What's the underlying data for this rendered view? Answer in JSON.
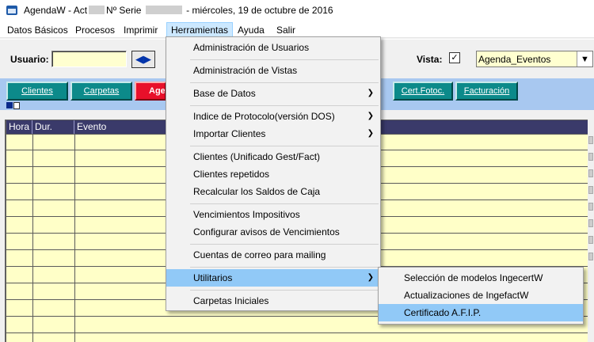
{
  "window": {
    "title_prefix": "AgendaW - Act",
    "title_serie": "Nº Serie",
    "title_date": "- miércoles, 19 de octubre de 2016"
  },
  "menubar": {
    "items": [
      {
        "label": "Datos Básicos"
      },
      {
        "label": "Procesos"
      },
      {
        "label": "Imprimir"
      },
      {
        "label": "Herramientas",
        "active": true
      },
      {
        "label": "Ayuda"
      },
      {
        "label": "Salir"
      }
    ]
  },
  "toolbar": {
    "usuario_label": "Usuario:",
    "usuario_value": "",
    "vista_label": "Vista:",
    "vista_checked": true,
    "vista_value": "Agenda_Eventos"
  },
  "tabs": [
    {
      "label": "Clientes"
    },
    {
      "label": "Carpetas"
    },
    {
      "label": "Age"
    },
    {
      "label": "Cert.Fotoc."
    },
    {
      "label": "Facturación"
    }
  ],
  "grid": {
    "columns": [
      "Hora",
      "Dur.",
      "Evento"
    ]
  },
  "herramientas_menu": {
    "items": [
      {
        "label": "Administración de Usuarios"
      },
      {
        "label": "Administración de Vistas"
      },
      {
        "label": "Base de Datos",
        "submenu": true
      },
      {
        "label": "Indice de Protocolo(versión DOS)",
        "submenu": true
      },
      {
        "label": "Importar Clientes",
        "submenu": true
      },
      {
        "label": "Clientes (Unificado Gest/Fact)"
      },
      {
        "label": "Clientes repetidos"
      },
      {
        "label": "Recalcular los Saldos de Caja"
      },
      {
        "label": "Vencimientos Impositivos"
      },
      {
        "label": "Configurar avisos de Vencimientos"
      },
      {
        "label": "Cuentas de correo para mailing"
      },
      {
        "label": "Utilitarios",
        "submenu": true,
        "highlighted": true
      },
      {
        "label": "Carpetas Iniciales"
      }
    ]
  },
  "utilitarios_submenu": {
    "items": [
      {
        "label": "Selección de modelos IngecertW"
      },
      {
        "label": "Actualizaciones de IngefactW"
      },
      {
        "label": "Certificado A.F.I.P.",
        "highlighted": true
      }
    ]
  },
  "colors": {
    "tab_teal": "#0c8a8a",
    "tab_red": "#e8102a",
    "highlight": "#91c9f7",
    "input_yellow": "#ffffd0",
    "grid_header": "#3a3a6a"
  },
  "icons": {
    "app": "folder-app-icon",
    "swap": "double-arrow-icon",
    "submenu": "chevron-right-icon",
    "dropdown": "chevron-down-icon"
  }
}
